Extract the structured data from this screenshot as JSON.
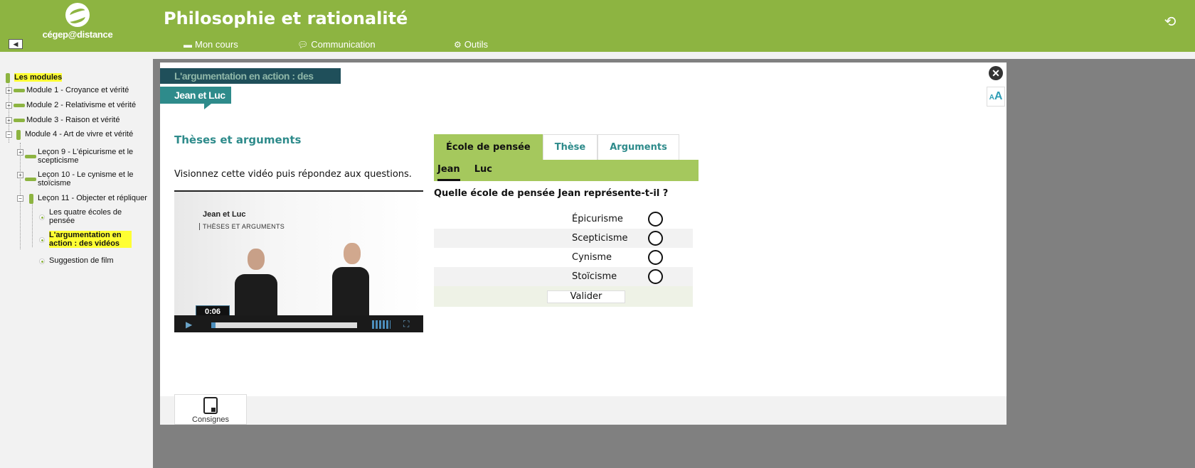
{
  "header": {
    "logo_text": "cégep@distance",
    "title": "Philosophie et rationalité",
    "nav": [
      {
        "label": "Mon cours",
        "icon": "book-icon"
      },
      {
        "label": "Communication",
        "icon": "chat-bubble-icon"
      },
      {
        "label": "Outils",
        "icon": "gear-icon"
      }
    ]
  },
  "sidebar": {
    "root": "Les modules",
    "modules": [
      "Module 1 - Croyance et vérité",
      "Module 2 - Relativisme et vérité",
      "Module 3 - Raison et vérité",
      "Module 4 - Art de vivre et vérité"
    ],
    "lessons": [
      "Leçon 9 - L'épicurisme et le scepticisme",
      "Leçon 10 - Le cynisme et le stoïcisme",
      "Leçon 11 - Objecter et répliquer"
    ],
    "pages": [
      "Les quatre écoles de pensée",
      "L'argumentation en action : des vidéos",
      "Suggestion de film"
    ]
  },
  "content": {
    "banner": "L'argumentation en action : des vidéos",
    "tag": "Jean et Luc",
    "section_title": "Thèses et arguments",
    "instruction": "Visionnez cette vidéo puis répondez aux questions.",
    "video": {
      "title": "Jean et Luc",
      "subtitle": "THÈSES ET ARGUMENTS",
      "time": "0:06",
      "progress": 0.03
    },
    "tabs": [
      "École de pensée",
      "Thèse",
      "Arguments"
    ],
    "subtabs": [
      "Jean",
      "Luc"
    ],
    "question": "Quelle école de pensée Jean représente-t-il ?",
    "options": [
      "Épicurisme",
      "Scepticisme",
      "Cynisme",
      "Stoïcisme"
    ],
    "validate_label": "Valider",
    "consignes_label": "Consignes"
  },
  "colors": {
    "brand_green": "#8db441",
    "tab_green": "#a5c85d",
    "teal": "#2e8b8b",
    "highlight": "#ffff33"
  }
}
